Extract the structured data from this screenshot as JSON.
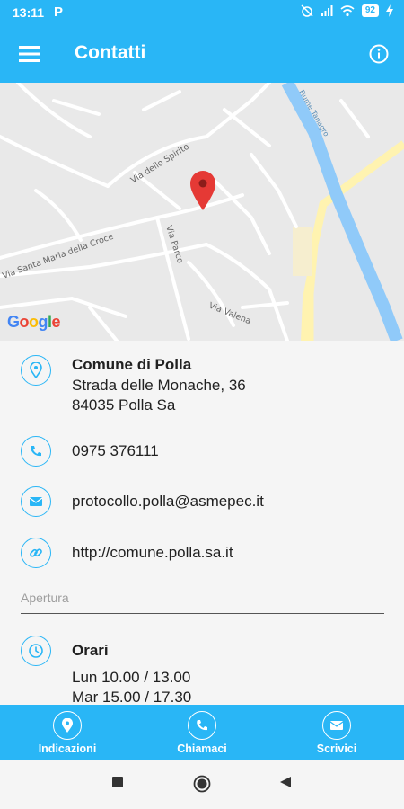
{
  "status_bar": {
    "time": "13:11",
    "carrier_icon": "P",
    "battery": "92"
  },
  "app_bar": {
    "title": "Contatti"
  },
  "map": {
    "logo": "Google",
    "streets": [
      "Via dello Spirito",
      "Via Santa Maria della Croce",
      "Via Parco",
      "Via Valena",
      "Fiume Tanagro"
    ]
  },
  "contact": {
    "name": "Comune di Polla",
    "address_line1": "Strada delle Monache, 36",
    "address_line2": "84035 Polla Sa",
    "phone": "0975 376111",
    "email": "protocollo.polla@asmepec.it",
    "website": "http://comune.polla.sa.it"
  },
  "opening": {
    "section_label": "Apertura",
    "title": "Orari",
    "line1": "Lun 10.00 / 13.00",
    "line2": "Mar 15.00 / 17.30"
  },
  "bottom_bar": {
    "directions": "Indicazioni",
    "call": "Chiamaci",
    "write": "Scrivici"
  },
  "colors": {
    "accent": "#29b6f6",
    "pin": "#e53935",
    "river": "#90caf9",
    "road_major": "#fff3b0"
  }
}
